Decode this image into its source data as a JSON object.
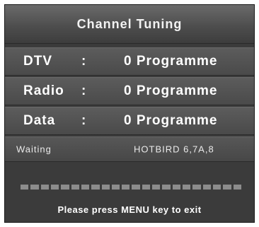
{
  "title": "Channel Tuning",
  "rows": [
    {
      "label": "DTV",
      "sep": ":",
      "value": "0 Programme"
    },
    {
      "label": "Radio",
      "sep": ":",
      "value": "0 Programme"
    },
    {
      "label": "Data",
      "sep": ":",
      "value": "0 Programme"
    }
  ],
  "status": {
    "state": "Waiting",
    "satellite": "HOTBIRD 6,7A,8"
  },
  "progress": {
    "fraction": 0,
    "segments": 22
  },
  "hint": "Please press MENU key to exit",
  "colors": {
    "panel": "#3b3b3b",
    "row": "#525252",
    "progress_segment": "#8c8c8c",
    "text": "#ffffff"
  }
}
